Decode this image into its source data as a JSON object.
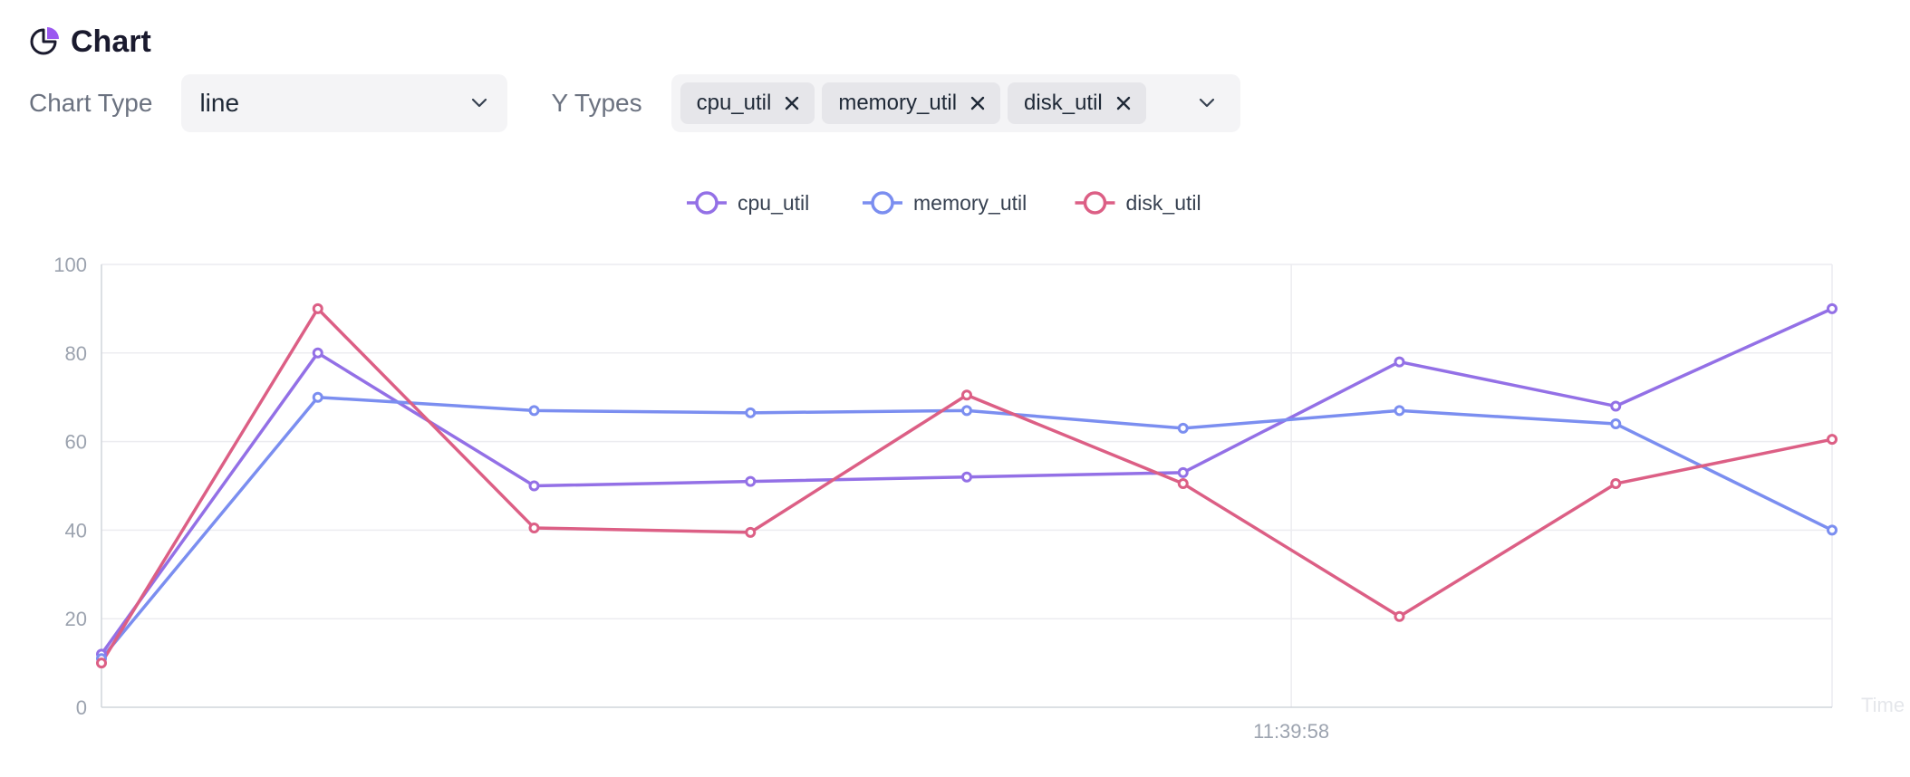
{
  "header": {
    "title": "Chart",
    "icon": "pie-chart-icon"
  },
  "controls": {
    "chart_type_label": "Chart Type",
    "chart_type_value": "line",
    "y_types_label": "Y Types",
    "y_types": [
      "cpu_util",
      "memory_util",
      "disk_util"
    ]
  },
  "chart_data": {
    "type": "line",
    "x": [
      "",
      "",
      "",
      "",
      "",
      "11:39:58",
      "",
      "",
      ""
    ],
    "series": [
      {
        "name": "cpu_util",
        "color": "#9370e6",
        "values": [
          12,
          80,
          50,
          51,
          52,
          53,
          78,
          68,
          90
        ]
      },
      {
        "name": "memory_util",
        "color": "#7b8ef0",
        "values": [
          11,
          70,
          67,
          66.5,
          67,
          63,
          67,
          64,
          40
        ]
      },
      {
        "name": "disk_util",
        "color": "#dc5f85",
        "values": [
          10,
          90,
          40.5,
          39.5,
          70.5,
          50.5,
          20.5,
          50.5,
          60.5
        ]
      }
    ],
    "ylim": [
      0,
      100
    ],
    "yticks": [
      0,
      20,
      40,
      60,
      80,
      100
    ],
    "xlabel": "Time",
    "ylabel": "",
    "legend": "top-center",
    "grid": true
  }
}
